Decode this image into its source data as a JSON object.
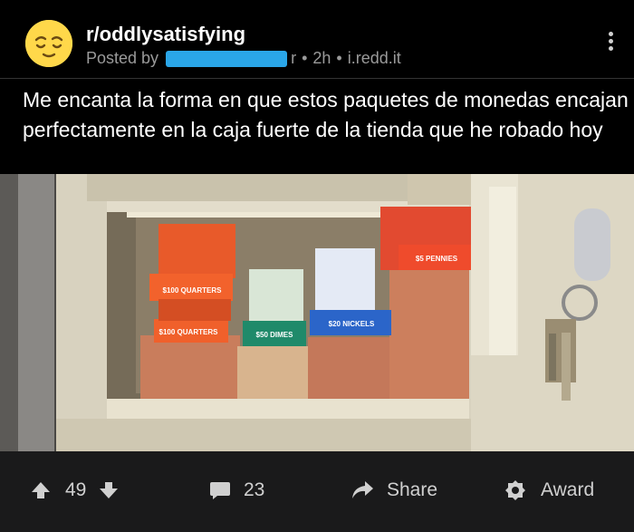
{
  "header": {
    "subreddit": "r/oddlysatisfying",
    "posted_by": "Posted by",
    "username_tail": "r",
    "age": "2h",
    "domain": "i.redd.it",
    "separator": "•"
  },
  "post": {
    "title": "Me encanta la forma en que estos paquetes de monedas encajan perfectamente en la caja fuerte de la tienda que he robado hoy"
  },
  "image": {
    "labels": {
      "quarters_a": "$100 QUARTERS",
      "quarters_b": "$100 QUARTERS",
      "dimes": "$50 DIMES",
      "nickels": "$20 NICKELS",
      "pennies": "$5 PENNIES"
    }
  },
  "footer": {
    "upvotes": "49",
    "comments": "23",
    "share": "Share",
    "award": "Award"
  },
  "colors": {
    "background": "#000000",
    "footer_bg": "#1a1a1b",
    "avatar": "#ffd84a",
    "redaction": "#2aa6e8",
    "meta_text": "#9a9a9a"
  },
  "icons": [
    "kebab-menu-icon",
    "upvote-arrow-icon",
    "downvote-arrow-icon",
    "comment-bubble-icon",
    "share-arrow-icon",
    "award-icon"
  ]
}
